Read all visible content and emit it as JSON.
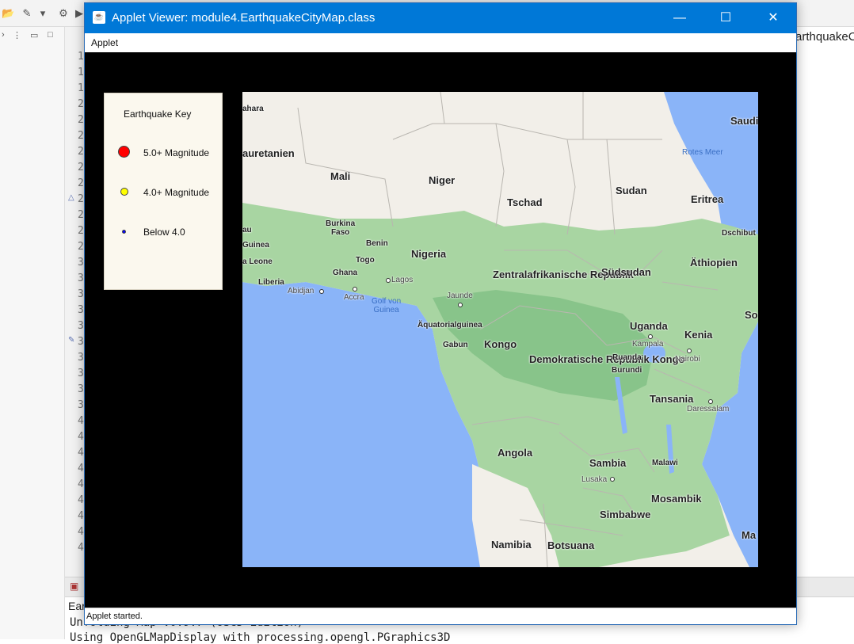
{
  "ide": {
    "line_numbers": [
      "1",
      "1",
      "1",
      "2",
      "2",
      "2",
      "2",
      "2",
      "2",
      "2",
      "2",
      "2",
      "2",
      "3",
      "3",
      "3",
      "3",
      "3",
      "3",
      "3",
      "3",
      "3",
      "3",
      "4",
      "4",
      "4",
      "4",
      "4",
      "4",
      "4",
      "4",
      "4"
    ],
    "tab_title": "arthquakeC",
    "console_label": "Ear",
    "console_lines": [
      "Unfolding Map v0.9.7 (OSGD Edition)",
      "Using OpenGLMapDisplay with processing.opengl.PGraphics3D"
    ]
  },
  "window": {
    "title": "Applet Viewer: module4.EarthquakeCityMap.class",
    "minimize_icon": "minimize-icon",
    "maximize_icon": "maximize-icon",
    "close_icon": "close-icon",
    "menu": [
      "Applet"
    ],
    "status": "Applet started."
  },
  "key": {
    "title": "Earthquake Key",
    "entries": [
      {
        "label": "5.0+ Magnitude",
        "color": "#ff0000"
      },
      {
        "label": "4.0+ Magnitude",
        "color": "#ffff00"
      },
      {
        "label": "Below 4.0",
        "color": "#0000ff"
      }
    ]
  },
  "map": {
    "countries": [
      "Mali",
      "Niger",
      "Tschad",
      "Sudan",
      "Eritrea",
      "Nigeria",
      "Zentralafrikanische Republik",
      "Südsudan",
      "Äthiopien",
      "Kongo",
      "Demokratische Republik Kongo",
      "Uganda",
      "Kenia",
      "Tansania",
      "Angola",
      "Sambia",
      "Malawi",
      "Mosambik",
      "Simbabwe",
      "Namibia",
      "Botsuana"
    ],
    "labels": {
      "sahara": "ahara",
      "mauretanien": "auretanien",
      "saudi": "Saudi",
      "burkina": "Burkina\nFaso",
      "benin": "Benin",
      "togo": "Togo",
      "ghana": "Ghana",
      "guinea": "Guinea",
      "sierra": "a Leone",
      "liberia": "Liberia",
      "au": "au",
      "dschibuti": "Dschibut",
      "so": "So",
      "ma": "Ma",
      "aequatorial": "Äquatorialguinea",
      "gabun": "Gabun",
      "ruanda": "Ruanda",
      "burundi": "Burundi"
    },
    "cities": [
      "Abidjan",
      "Accra",
      "Lagos",
      "Jaunde",
      "Kampala",
      "Nairobi",
      "Daressalam",
      "Lusaka"
    ],
    "seas": [
      "Rotes Meer",
      "Golf von\nGuinea"
    ]
  }
}
